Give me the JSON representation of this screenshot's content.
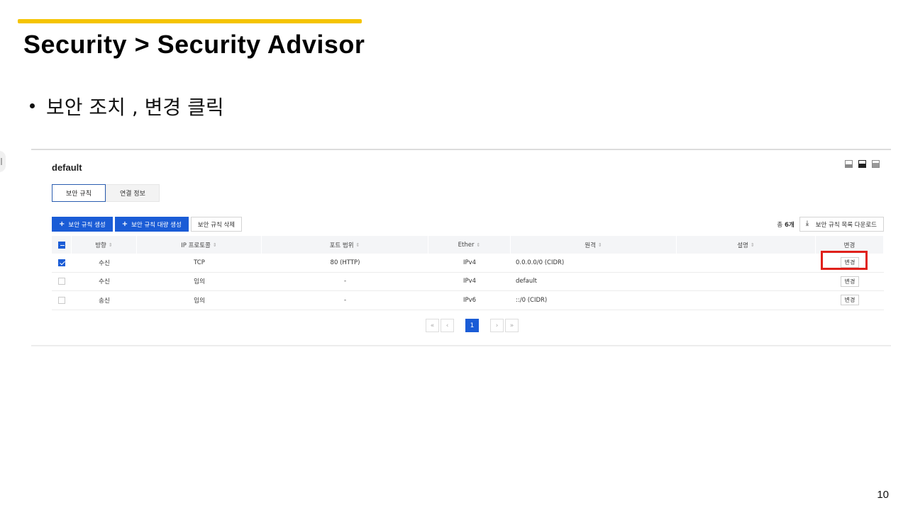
{
  "slide": {
    "title": "Security > Security Advisor",
    "bullet": "보안 조치 , 변경 클릭",
    "page_number": "10"
  },
  "panel": {
    "group_name": "default",
    "tabs": [
      {
        "label": "보안 규칙",
        "active": true
      },
      {
        "label": "연결 정보",
        "active": false
      }
    ],
    "toolbar": {
      "create_rule": "보안 규칙 생성",
      "bulk_create": "보안 규칙 대량 생성",
      "delete_rule": "보안 규칙 삭제",
      "total_prefix": "총",
      "total_count": "6개",
      "download": "보안 규칙 목록 다운로드"
    },
    "columns": [
      "방향",
      "IP 프로토콜",
      "포트 범위",
      "Ether",
      "원격",
      "설명",
      "변경"
    ],
    "rows": [
      {
        "checked": true,
        "direction": "수신",
        "protocol": "TCP",
        "port": "80 (HTTP)",
        "ether": "IPv4",
        "remote": "0.0.0.0/0 (CIDR)",
        "description": "",
        "edit": "변경"
      },
      {
        "checked": false,
        "direction": "수신",
        "protocol": "임의",
        "port": "-",
        "ether": "IPv4",
        "remote": "default",
        "description": "",
        "edit": "변경"
      },
      {
        "checked": false,
        "direction": "송신",
        "protocol": "임의",
        "port": "-",
        "ether": "IPv6",
        "remote": "::/0 (CIDR)",
        "description": "",
        "edit": "변경"
      }
    ],
    "pagination": {
      "first": "«",
      "prev": "‹",
      "current": "1",
      "next": "›",
      "last": "»"
    }
  },
  "colors": {
    "accent_bar": "#f5c400",
    "primary": "#1a5cd6",
    "highlight": "#e0201b"
  }
}
